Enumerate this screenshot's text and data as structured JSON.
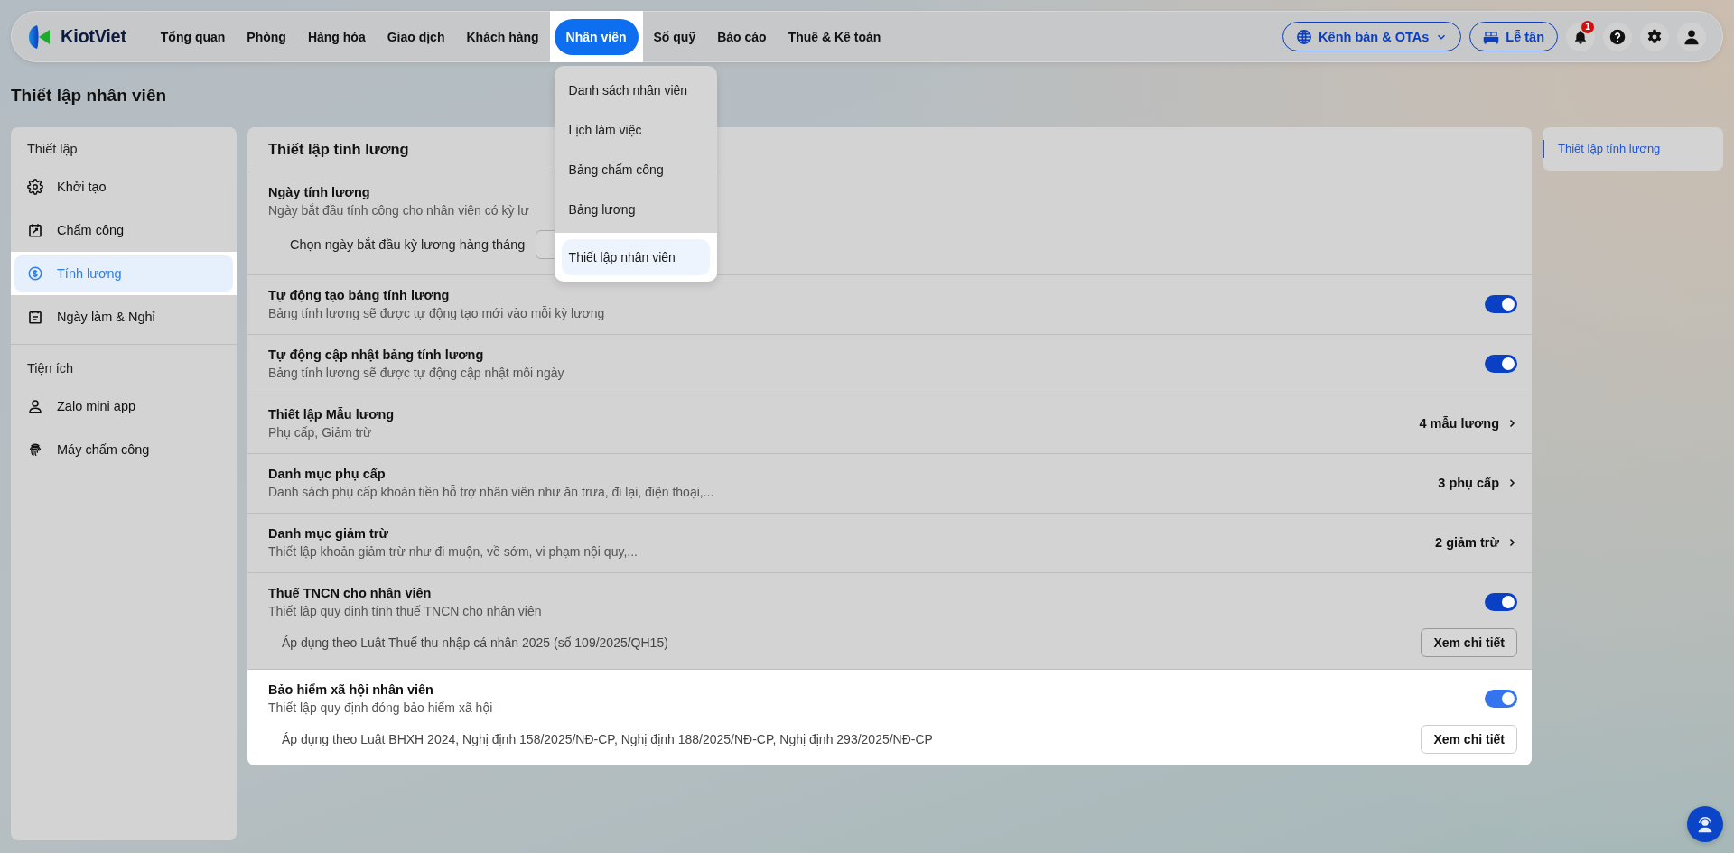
{
  "header": {
    "logo": "KiotViet",
    "nav": [
      {
        "label": "Tổng quan",
        "selected": false,
        "spotlight": false
      },
      {
        "label": "Phòng",
        "selected": false,
        "spotlight": false
      },
      {
        "label": "Hàng hóa",
        "selected": false,
        "spotlight": false
      },
      {
        "label": "Giao dịch",
        "selected": false,
        "spotlight": false
      },
      {
        "label": "Khách hàng",
        "selected": false,
        "spotlight": false
      },
      {
        "label": "Nhân viên",
        "selected": true,
        "spotlight": true
      },
      {
        "label": "Sổ quỹ",
        "selected": false,
        "spotlight": false
      },
      {
        "label": "Báo cáo",
        "selected": false,
        "spotlight": false
      },
      {
        "label": "Thuế & Kế toán",
        "selected": false,
        "spotlight": false
      }
    ],
    "channels_button": "Kênh bán & OTAs",
    "reception_button": "Lễ tân",
    "notification_badge": "1"
  },
  "nav_menu": {
    "items": [
      {
        "label": "Danh sách nhân viên",
        "spotlight": false
      },
      {
        "label": "Lịch làm việc",
        "spotlight": false
      },
      {
        "label": "Bảng chấm công",
        "spotlight": false
      },
      {
        "label": "Bảng lương",
        "spotlight": false
      },
      {
        "label": "Thiết lập nhân viên",
        "spotlight": true
      }
    ]
  },
  "page_title": "Thiết lập nhân viên",
  "sidebar": {
    "sections": [
      {
        "title": "Thiết lập",
        "items": [
          {
            "label": "Khởi tạo",
            "selected": false,
            "spotlight": false
          },
          {
            "label": "Chấm công",
            "selected": false,
            "spotlight": false
          },
          {
            "label": "Tính lương",
            "selected": true,
            "spotlight": true
          },
          {
            "label": "Ngày làm & Nghỉ",
            "selected": false,
            "spotlight": false
          }
        ]
      },
      {
        "title": "Tiện ích",
        "items": [
          {
            "label": "Zalo mini app",
            "selected": false,
            "spotlight": false
          },
          {
            "label": "Máy chấm công",
            "selected": false,
            "spotlight": false
          }
        ]
      }
    ]
  },
  "card": {
    "title": "Thiết lập tính lương",
    "rows": [
      {
        "kind": "field",
        "title": "Ngày tính lương",
        "description": "Ngày bắt đầu tính công cho nhân viên có kỳ lư",
        "field_label": "Chọn ngày bắt đầu kỳ lương hàng tháng",
        "spotlight": false
      },
      {
        "kind": "toggle",
        "title": "Tự động tạo bảng tính lương",
        "description": "Bảng tính lương sẽ được tự động tạo mới vào mỗi kỳ lương",
        "on": true,
        "spotlight": false
      },
      {
        "kind": "toggle",
        "title": "Tự động cập nhật bảng tính lương",
        "description": "Bảng tính lương sẽ được tự động cập nhật mỗi ngày",
        "on": true,
        "spotlight": false
      },
      {
        "kind": "link",
        "title": "Thiết lập Mẫu lương",
        "description": "Phụ cấp, Giảm trừ",
        "value": "4 mẫu lương",
        "spotlight": false
      },
      {
        "kind": "link",
        "title": "Danh mục phụ cấp",
        "description": "Danh sách phụ cấp khoản tiền hỗ trợ nhân viên như ăn trưa, đi lại, điện thoại,...",
        "value": "3 phụ cấp",
        "spotlight": false
      },
      {
        "kind": "link",
        "title": "Danh mục giảm trừ",
        "description": "Thiết lập khoản giảm trừ như đi muộn, về sớm, vi phạm nội quy,...",
        "value": "2 giảm trừ",
        "spotlight": false
      },
      {
        "kind": "toggle_detail",
        "title": "Thuế TNCN cho nhân viên",
        "description": "Thiết lập quy định tính thuế TNCN cho nhân viên",
        "on": true,
        "note": "Áp dụng theo Luật Thuế thu nhập cá nhân 2025 (số 109/2025/QH15)",
        "button": "Xem chi tiết",
        "spotlight": false
      },
      {
        "kind": "toggle_detail",
        "title": "Bảo hiểm xã hội nhân viên",
        "description": "Thiết lập quy định đóng bảo hiểm xã hội",
        "on": true,
        "note": "Áp dụng theo Luật BHXH 2024, Nghị định 158/2025/NĐ-CP, Nghị định 188/2025/NĐ-CP, Nghị định 293/2025/NĐ-CP",
        "button": "Xem chi tiết",
        "spotlight": true
      }
    ]
  },
  "toc": {
    "items": [
      {
        "label": "Thiết lập tính lương",
        "selected": true
      }
    ]
  }
}
